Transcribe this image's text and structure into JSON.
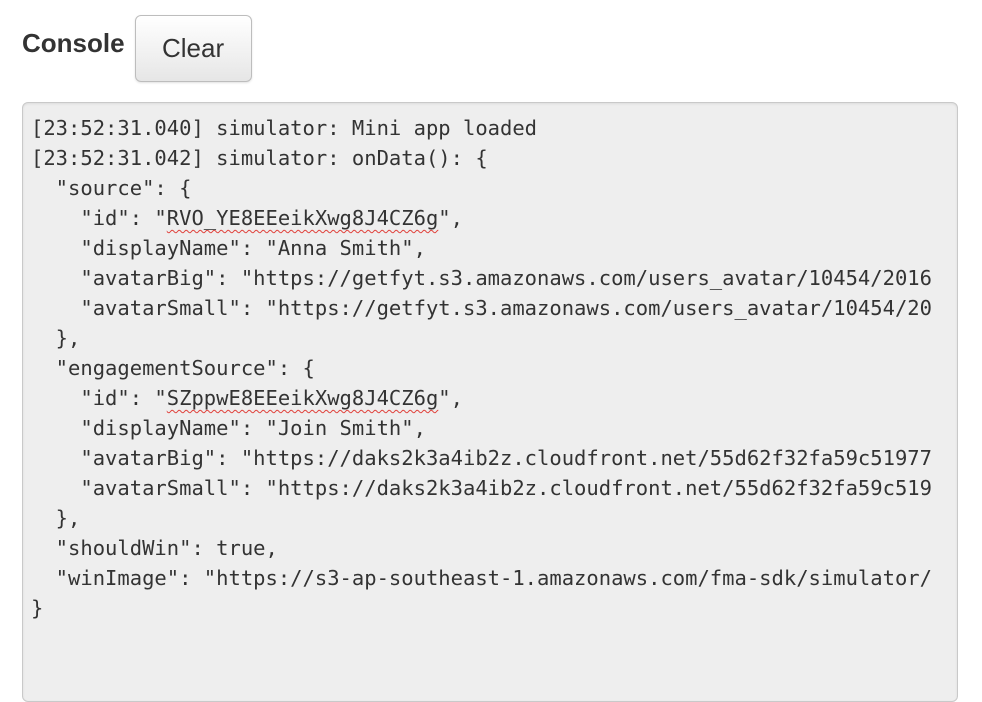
{
  "header": {
    "title": "Console",
    "clear_label": "Clear"
  },
  "console": {
    "lines": [
      "[23:52:31.040] simulator: Mini app loaded",
      "[23:52:31.042] simulator: onData(): {",
      "  \"source\": {",
      [
        "    \"id\": \"",
        {
          "spell": "RVO_YE8EEeikXwg8J4CZ6g"
        },
        "\","
      ],
      "    \"displayName\": \"Anna Smith\",",
      "    \"avatarBig\": \"https://getfyt.s3.amazonaws.com/users_avatar/10454/2016",
      "    \"avatarSmall\": \"https://getfyt.s3.amazonaws.com/users_avatar/10454/20",
      "  },",
      "  \"engagementSource\": {",
      [
        "    \"id\": \"",
        {
          "spell": "SZppwE8EEeikXwg8J4CZ6g"
        },
        "\","
      ],
      "    \"displayName\": \"Join Smith\",",
      "    \"avatarBig\": \"https://daks2k3a4ib2z.cloudfront.net/55d62f32fa59c51977",
      "    \"avatarSmall\": \"https://daks2k3a4ib2z.cloudfront.net/55d62f32fa59c519",
      "  },",
      "  \"shouldWin\": true,",
      "  \"winImage\": \"https://s3-ap-southeast-1.amazonaws.com/fma-sdk/simulator/",
      "}"
    ]
  }
}
